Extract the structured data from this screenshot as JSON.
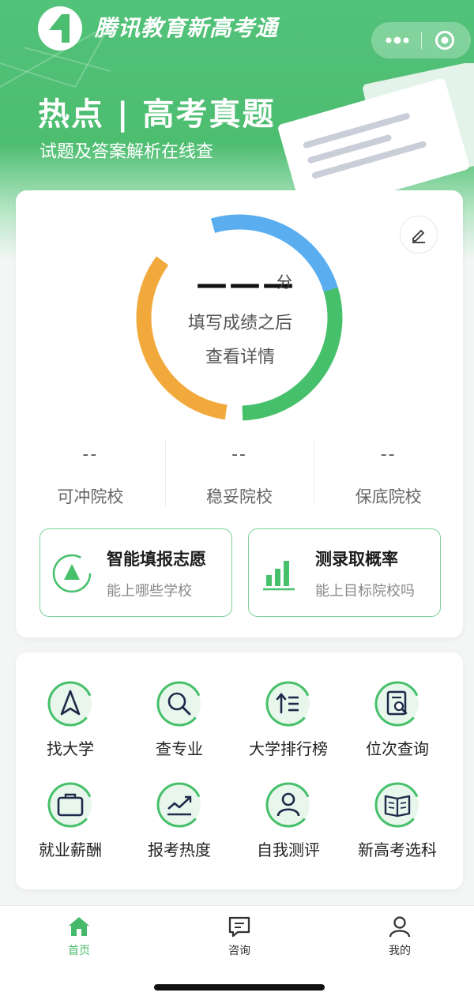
{
  "header": {
    "app_title": "腾讯教育新高考通",
    "headline": "热点 | 高考真题",
    "subtitle": "试题及答案解析在线查"
  },
  "score_card": {
    "score": "———",
    "unit": "分",
    "prompt_line1": "填写成绩之后",
    "prompt_line2": "查看详情",
    "stats": [
      {
        "value": "--",
        "label": "可冲院校"
      },
      {
        "value": "--",
        "label": "稳妥院校"
      },
      {
        "value": "--",
        "label": "保底院校"
      }
    ],
    "actions": [
      {
        "title": "智能填报志愿",
        "desc": "能上哪些学校",
        "icon": "triangle-target-icon"
      },
      {
        "title": "测录取概率",
        "desc": "能上目标院校吗",
        "icon": "bar-chart-icon"
      }
    ],
    "ring_colors": {
      "blue": "#5aaef0",
      "green": "#46c06a",
      "orange": "#f2a93b"
    }
  },
  "features": [
    {
      "label": "找大学",
      "icon": "navigation-arrow-icon"
    },
    {
      "label": "查专业",
      "icon": "search-icon"
    },
    {
      "label": "大学排行榜",
      "icon": "ranking-list-icon"
    },
    {
      "label": "位次查询",
      "icon": "document-search-icon"
    },
    {
      "label": "就业薪酬",
      "icon": "briefcase-icon"
    },
    {
      "label": "报考热度",
      "icon": "trend-chart-icon"
    },
    {
      "label": "自我测评",
      "icon": "person-icon"
    },
    {
      "label": "新高考选科",
      "icon": "open-book-icon"
    }
  ],
  "tabbar": {
    "tabs": [
      {
        "label": "首页",
        "icon": "home-icon",
        "active": true
      },
      {
        "label": "咨询",
        "icon": "chat-icon",
        "active": false
      },
      {
        "label": "我的",
        "icon": "user-icon",
        "active": false
      }
    ]
  },
  "colors": {
    "brand": "#4dbd70",
    "active_tab": "#46b96b",
    "inactive_tab": "#333333"
  }
}
